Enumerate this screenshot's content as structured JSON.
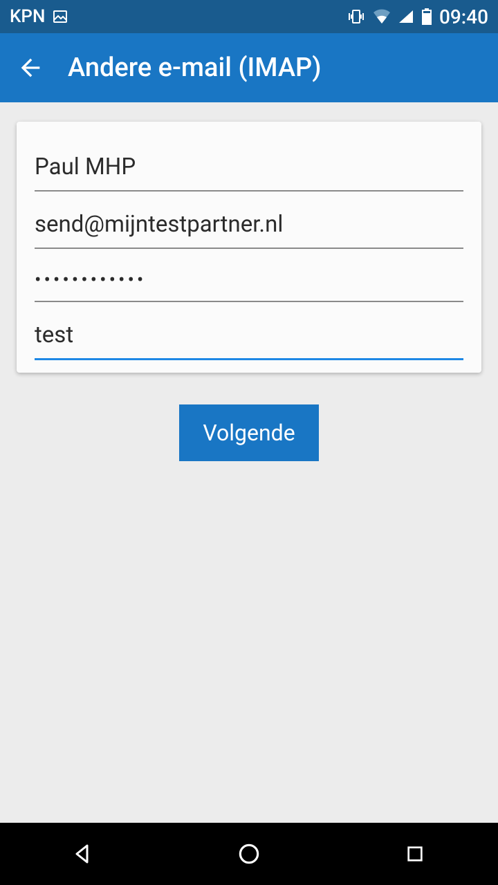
{
  "statusbar": {
    "carrier": "KPN",
    "time": "09:40"
  },
  "appbar": {
    "title": "Andere e-mail (IMAP)"
  },
  "form": {
    "display_name": "Paul MHP",
    "email": "send@mijntestpartner.nl",
    "password": "••••••••••••",
    "description": "test"
  },
  "buttons": {
    "next": "Volgende"
  }
}
